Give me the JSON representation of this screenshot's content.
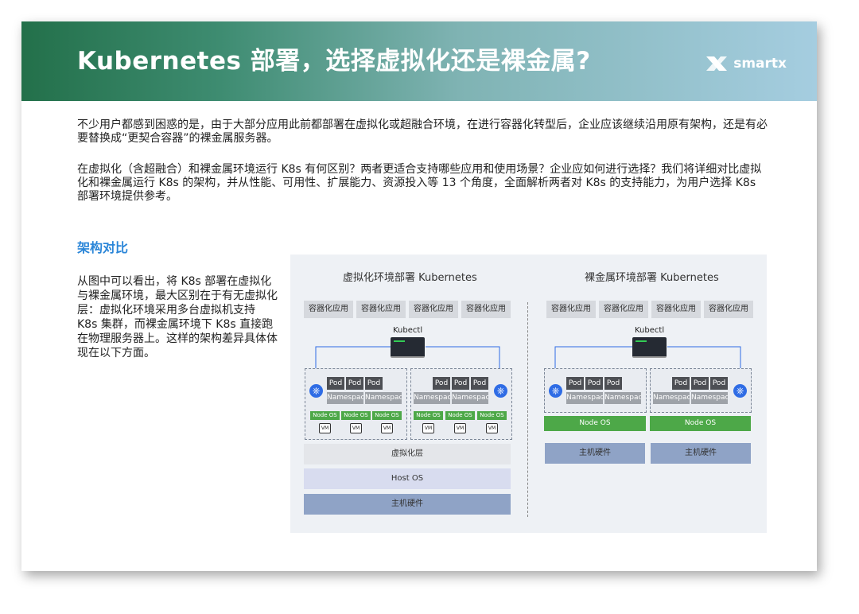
{
  "header": {
    "title": "Kubernetes 部署，选择虚拟化还是裸金属?",
    "logo_text": "smartx"
  },
  "intro": {
    "p1": "不少用户都感到困惑的是，由于大部分应用此前都部署在虚拟化或超融合环境，在进行容器化转型后，企业应该继续沿用原有架构，还是有必要替换成“更契合容器”的裸金属服务器。",
    "p2": "在虚拟化（含超融合）和裸金属环境运行 K8s 有何区别？两者更适合支持哪些应用和使用场景？企业应如何进行选择？我们将详细对比虚拟化和裸金属运行 K8s 的架构，并从性能、可用性、扩展能力、资源投入等 13 个角度，全面解析两者对 K8s 的支持能力，为用户选择 K8s 部署环境提供参考。"
  },
  "section": {
    "title": "架构对比",
    "body": "从图中可以看出，将 K8s 部署在虚拟化与裸金属环境，最大区别在于有无虚拟化层：虚拟化环境采用多台虚拟机支持 K8s 集群，而裸金属环境下 K8s 直接跑在物理服务器上。这样的架构差异具体体现在以下方面。"
  },
  "diagram": {
    "left_title": "虚拟化环境部署 Kubernetes",
    "right_title": "裸金属环境部署 Kubernetes",
    "app_label": "容器化应用",
    "kubectl": "Kubectl",
    "pod": "Pod",
    "namespace": "Namespace",
    "node_os": "Node OS",
    "vm": "VM",
    "virt_layer": "虚拟化层",
    "host_os": "Host OS",
    "hardware": "主机硬件",
    "k8s_icon": "kubernetes-helm-icon",
    "colors": {
      "node_os": "#4da848",
      "hardware": "#8fa3c6",
      "host_os": "#d8dcef",
      "virt_layer": "#e4e6ea",
      "k8s": "#2f6ce5"
    }
  }
}
